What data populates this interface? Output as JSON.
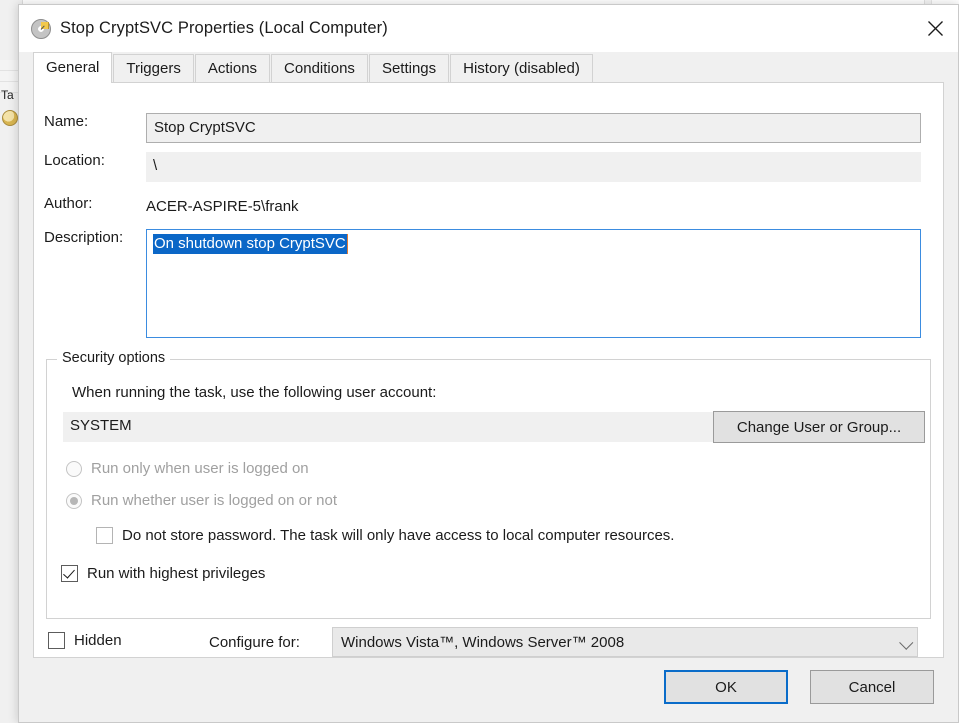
{
  "background": {
    "left_label": "Ta",
    "left_icon": "task-clock-icon"
  },
  "dialog": {
    "icon": "clock-schedule-icon",
    "title": "Stop CryptSVC Properties (Local Computer)",
    "close_icon": "close-icon"
  },
  "tabs": [
    {
      "label": "General",
      "active": true
    },
    {
      "label": "Triggers",
      "active": false
    },
    {
      "label": "Actions",
      "active": false
    },
    {
      "label": "Conditions",
      "active": false
    },
    {
      "label": "Settings",
      "active": false
    },
    {
      "label": "History (disabled)",
      "active": false
    }
  ],
  "general": {
    "name_label": "Name:",
    "name_value": "Stop CryptSVC",
    "location_label": "Location:",
    "location_value": "\\",
    "author_label": "Author:",
    "author_value": "ACER-ASPIRE-5\\frank",
    "description_label": "Description:",
    "description_value": "On shutdown stop CryptSVC"
  },
  "security": {
    "group_title": "Security options",
    "account_prompt": "When running the task, use the following user account:",
    "account_value": "SYSTEM",
    "change_user_button": "Change User or Group...",
    "radio_logged_on": "Run only when user is logged on",
    "radio_whether_logged_on": "Run whether user is logged on or not",
    "radio_selected": "Run whether user is logged on or not",
    "checkbox_no_password": "Do not store password.  The task will only have access to local computer resources.",
    "checkbox_no_password_checked": false,
    "checkbox_highest_privileges": "Run with highest privileges",
    "checkbox_highest_privileges_checked": true
  },
  "bottom": {
    "hidden_label": "Hidden",
    "hidden_checked": false,
    "configure_for_label": "Configure for:",
    "configure_for_value": "Windows Vista™, Windows Server™ 2008",
    "configure_for_chevron": "chevron-down-icon"
  },
  "footer": {
    "ok_label": "OK",
    "cancel_label": "Cancel"
  },
  "colors": {
    "accent_blue": "#0a6cc9",
    "selection_blue": "#0b67c7",
    "focus_border": "#3b8ce0",
    "dialog_bg": "#f0f0f0",
    "field_bg": "#f0f0f0"
  }
}
